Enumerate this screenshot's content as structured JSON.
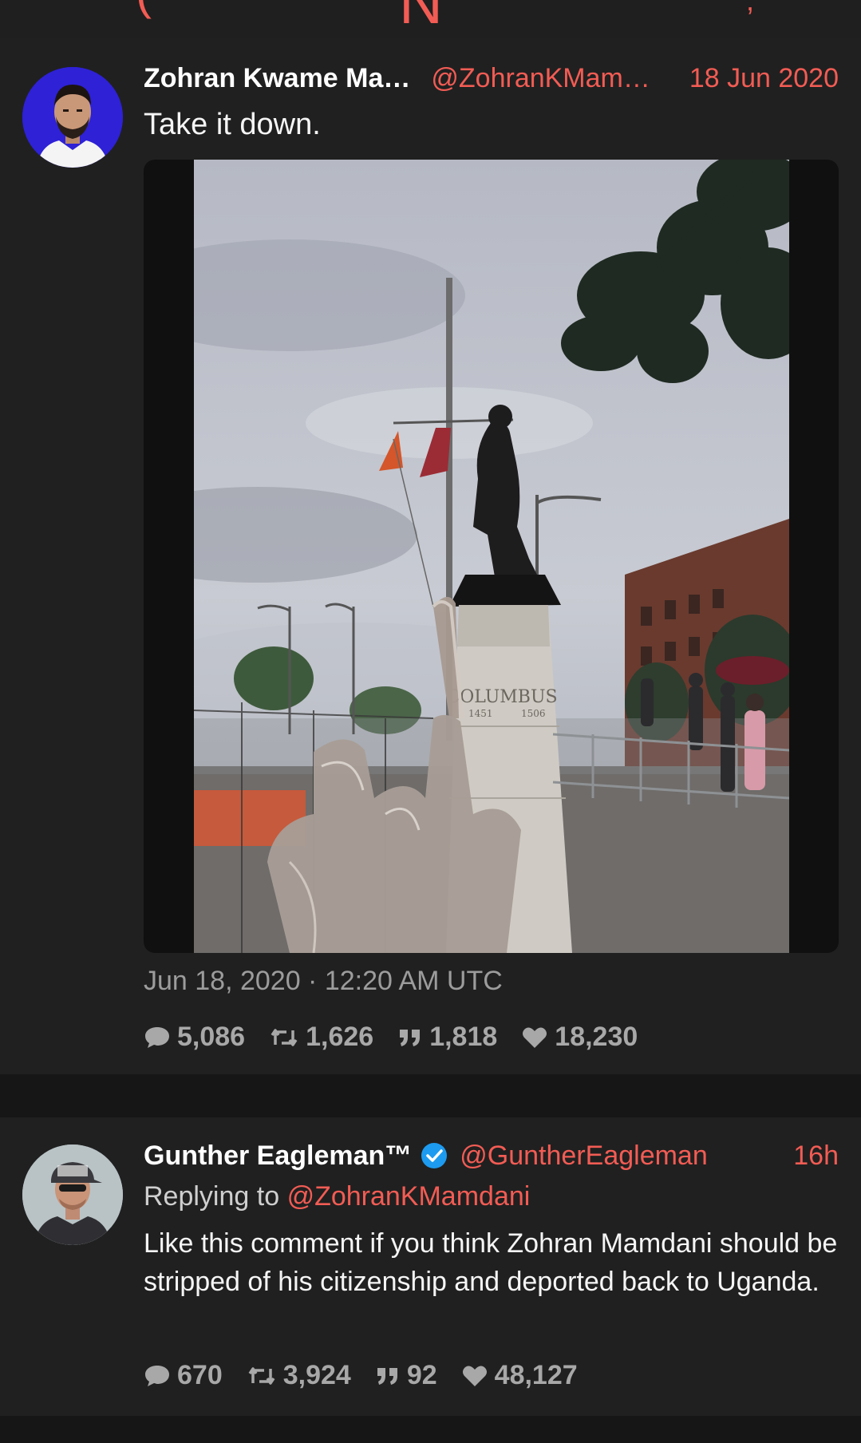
{
  "tweet": {
    "author_name": "Zohran Kwame Ma…",
    "author_handle": "@ZohranKMam…",
    "date": "18 Jun 2020",
    "text": "Take it down.",
    "photo_statue_inscription": "COLUMBUS",
    "photo_years_left": "1451",
    "photo_years_right": "1506",
    "timestamp": "Jun 18, 2020 · 12:20 AM UTC",
    "stats": {
      "comments": "5,086",
      "retweets": "1,626",
      "quotes": "1,818",
      "likes": "18,230"
    }
  },
  "reply": {
    "author_name": "Gunther Eagleman™",
    "author_handle": "@GuntherEagleman",
    "date": "16h",
    "replying_prefix": "Replying to",
    "replying_to": "@ZohranKMamdani",
    "text": "Like this comment if you think Zohran Mamdani should be stripped of his citizenship and deported back to Uganda.",
    "stats": {
      "comments": "670",
      "retweets": "3,924",
      "quotes": "92",
      "likes": "48,127"
    }
  },
  "colors": {
    "accent": "#f25c54",
    "background": "#161616",
    "card": "#202020",
    "muted": "#a8a8a8",
    "verified": "#1d9bf0"
  },
  "icons": [
    "comment-icon",
    "retweet-icon",
    "quote-icon",
    "heart-icon",
    "verified-badge-icon"
  ]
}
